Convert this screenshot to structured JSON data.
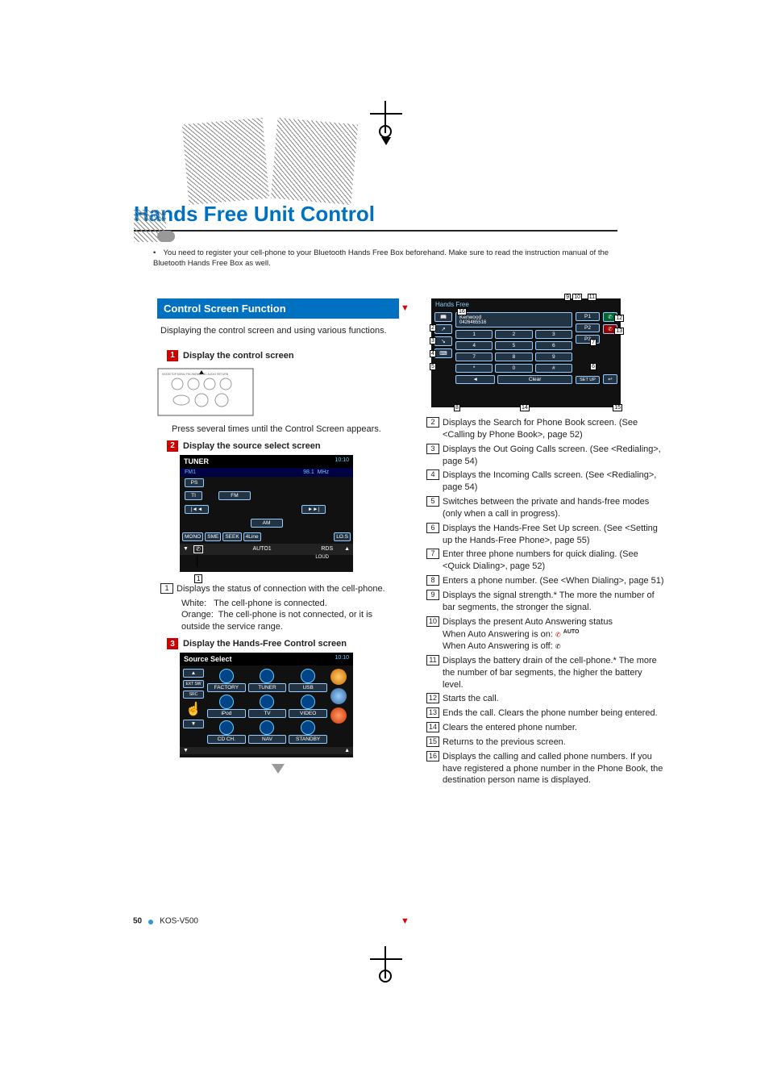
{
  "page": {
    "title": "Hands Free Unit Control",
    "note": "You need to register your cell-phone to your Bluetooth Hands Free Box beforehand. Make sure to read the instruction manual of the Bluetooth Hands Free Box as well.",
    "footer_page": "50",
    "footer_model": "KOS-V500"
  },
  "left": {
    "section_title": "Control Screen Function",
    "intro": "Displaying the control screen and using various functions.",
    "step1_label": "Display the control screen",
    "step1_text": "Press several times until the Control Screen appears.",
    "step2_label": "Display the source select screen",
    "tuner": {
      "title": "TUNER",
      "band": "FM1",
      "freq": "98.1",
      "unit": "MHz",
      "time": "10:10",
      "ps": "PS",
      "ti": "TI",
      "fm": "FM",
      "am": "AM",
      "prev": "|◄◄",
      "next": "►►|",
      "mono": "MONO",
      "sme": "SME",
      "seek": "SEEK",
      "fine": "4Line",
      "los": "LO.S",
      "auto1": "AUTO1",
      "rds": "RDS",
      "loud": "LOUD"
    },
    "item1_text": "Displays the status of connection with the cell-phone.",
    "item1_white_lbl": "White:",
    "item1_white_txt": "The cell-phone is connected.",
    "item1_orange_lbl": "Orange:",
    "item1_orange_txt": "The cell-phone is not connected, or it is outside the service range.",
    "step3_label": "Display the Hands-Free Control screen",
    "source": {
      "title": "Source Select",
      "time": "10:10",
      "factory": "FACTORY",
      "tuner": "TUNER",
      "usb": "USB",
      "ipod": "iPod",
      "tv": "TV",
      "video": "VIDEO",
      "cdch": "CD CH.",
      "nav": "NAV",
      "standby": "STANDBY",
      "ext_sw": "EXT SW",
      "src": "SRC"
    }
  },
  "right": {
    "hf": {
      "title": "Hands Free",
      "name": "Kenwood",
      "number": "0426465516",
      "p1": "P1",
      "p2": "P2",
      "p3": "P3",
      "setup": "SET UP",
      "clear": "Clear",
      "book_icon": "📖",
      "out_icon": "↗",
      "in_icon": "↘",
      "dial_icon": "⌨",
      "k1": "1",
      "k2": "2",
      "k3": "3",
      "k4": "4",
      "k5": "5",
      "k6": "6",
      "k7": "7",
      "k8": "8",
      "k9": "9",
      "kast": "*",
      "k0": "0",
      "khash": "#"
    },
    "items": [
      {
        "n": "2",
        "t": "Displays the Search for Phone Book screen. (See <Calling by Phone Book>, page 52)"
      },
      {
        "n": "3",
        "t": "Displays the Out Going Calls screen. (See <Redialing>, page 54)"
      },
      {
        "n": "4",
        "t": "Displays the Incoming Calls screen. (See <Redialing>, page 54)"
      },
      {
        "n": "5",
        "t": "Switches between the private and hands-free modes (only when a call in progress)."
      },
      {
        "n": "6",
        "t": "Displays the Hands-Free Set Up screen. (See <Setting up the Hands-Free Phone>, page 55)"
      },
      {
        "n": "7",
        "t": "Enter three phone numbers for quick dialing. (See <Quick Dialing>, page 52)"
      },
      {
        "n": "8",
        "t": "Enters a phone number. (See <When Dialing>, page 51)"
      },
      {
        "n": "9",
        "t": "Displays the signal strength.* The more the number of bar segments, the stronger the signal."
      },
      {
        "n": "10",
        "t": "Displays the present Auto Answering status"
      },
      {
        "n": "10a",
        "t": "When Auto Answering is on:"
      },
      {
        "n": "10b",
        "t": "When Auto Answering is off:"
      },
      {
        "n": "10_auto",
        "t": "AUTO"
      },
      {
        "n": "11",
        "t": "Displays the battery drain of the cell-phone.* The more the number of bar segments, the higher the battery level."
      },
      {
        "n": "12",
        "t": "Starts the call."
      },
      {
        "n": "13",
        "t": "Ends the call. Clears the phone number being entered."
      },
      {
        "n": "14",
        "t": "Clears the entered phone number."
      },
      {
        "n": "15",
        "t": "Returns to the previous screen."
      },
      {
        "n": "16",
        "t": "Displays the calling and called phone numbers. If you have registered a phone number in the Phone Book, the destination person name is displayed."
      }
    ]
  }
}
